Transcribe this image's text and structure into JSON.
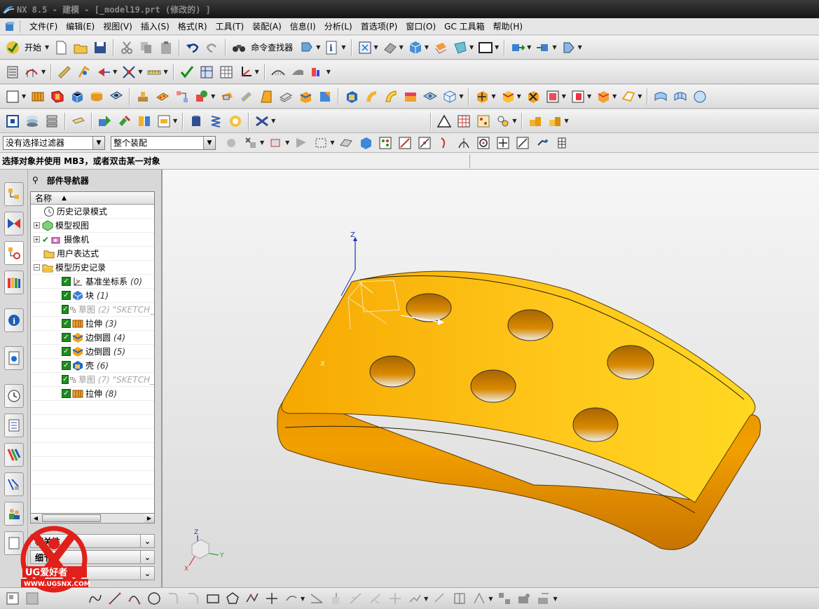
{
  "window": {
    "title": "NX 8.5 - 建模 - [_model19.prt  (修改的) ]"
  },
  "menu": [
    "文件(F)",
    "编辑(E)",
    "视图(V)",
    "插入(S)",
    "格式(R)",
    "工具(T)",
    "装配(A)",
    "信息(I)",
    "分析(L)",
    "首选项(P)",
    "窗口(O)",
    "GC 工具箱",
    "帮助(H)"
  ],
  "toolbar": {
    "start_label": "开始",
    "command_finder_label": "命令查找器"
  },
  "selection": {
    "filter": "没有选择过滤器",
    "scope": "整个装配"
  },
  "cue_line": "选择对象并使用 MB3，或者双击某一对象",
  "navigator": {
    "title": "部件导航器",
    "column_name": "名称",
    "items": [
      {
        "label": "历史记录模式",
        "icon": "clock-icon"
      },
      {
        "label": "模型视图",
        "icon": "model-view-icon"
      },
      {
        "label": "摄像机",
        "icon": "camera-icon"
      },
      {
        "label": "用户表达式",
        "icon": "folder-icon"
      },
      {
        "label": "模型历史记录",
        "icon": "folder-open-icon"
      }
    ],
    "features": [
      {
        "label": "基准坐标系",
        "ts": "(0)",
        "icon": "datum-csys-icon",
        "suppressed": false
      },
      {
        "label": "块",
        "ts": "(1)",
        "icon": "block-icon",
        "suppressed": false
      },
      {
        "label": "草图",
        "ts": "(2) \"SKETCH_",
        "icon": "sketch-icon",
        "suppressed": true
      },
      {
        "label": "拉伸",
        "ts": "(3)",
        "icon": "extrude-icon",
        "suppressed": false
      },
      {
        "label": "边倒圆",
        "ts": "(4)",
        "icon": "edge-blend-icon",
        "suppressed": false
      },
      {
        "label": "边倒圆",
        "ts": "(5)",
        "icon": "edge-blend-icon",
        "suppressed": false
      },
      {
        "label": "壳",
        "ts": "(6)",
        "icon": "shell-icon",
        "suppressed": false
      },
      {
        "label": "草图",
        "ts": "(7) \"SKETCH_",
        "icon": "sketch-icon",
        "suppressed": true
      },
      {
        "label": "拉伸",
        "ts": "(8)",
        "icon": "extrude-icon",
        "suppressed": false
      }
    ],
    "panels": [
      "相关性",
      "细节",
      "预览"
    ]
  },
  "axis": {
    "x": "X",
    "y": "Y",
    "z": "Z"
  },
  "watermark": {
    "brand": "UG爱好者",
    "url": "WWW.UGSNX.COM"
  },
  "colors": {
    "part": "#f2a400",
    "part_light": "#ffd21a",
    "titlebar": "#1e1e1e",
    "check": "#1f8a1f"
  }
}
